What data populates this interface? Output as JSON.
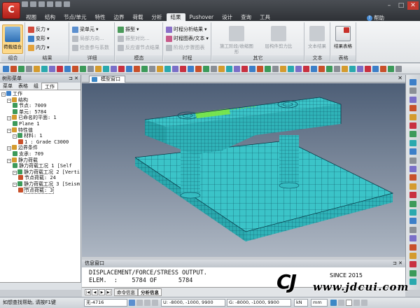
{
  "app": {
    "logo_text": "C",
    "menu_tabs": [
      "视图",
      "结构",
      "节点/单元",
      "特性",
      "边界",
      "荷载",
      "分析",
      "结果",
      "Pushover",
      "设计",
      "查询",
      "工具"
    ],
    "active_tab": "结果",
    "help_label": "帮助"
  },
  "ribbon": {
    "groups": {
      "combo": "组合",
      "results": "结果",
      "detail": "详细",
      "mode": "模态",
      "time": "时程",
      "other": "其它",
      "text": "文本",
      "table": "表格"
    },
    "load_combo_btn": "荷载组合",
    "reaction": "反力",
    "deform": "变形",
    "internal_force": "内力",
    "beam_element": "梁单元",
    "local_direction": "局部方向...",
    "check_params": "检查参与系数",
    "vibration_mode": "振型",
    "mode_compare": "振型对比...",
    "reaction_time": "反应谱节点结果",
    "time_history": "时程分析结果",
    "time_graph": "时程图表/文本",
    "step_graph": "阶段/步骤图表",
    "construction_stage": "施工阶段/收缩图形",
    "member_force_ratio": "层构件剪力比",
    "text_result": "文本结果",
    "result_table": "结果表格"
  },
  "tree": {
    "panel_title": "树形菜单",
    "tabs": [
      "菜单",
      "表格",
      "组",
      "工作"
    ],
    "active_tab": "工作",
    "nodes": [
      {
        "depth": 0,
        "label": "工作",
        "icon": "work-icon"
      },
      {
        "depth": 1,
        "label": "结构",
        "icon": "structure-icon"
      },
      {
        "depth": 2,
        "label": "节点: 7009",
        "icon": "node-icon"
      },
      {
        "depth": 2,
        "label": "单元: 5784",
        "icon": "element-icon"
      },
      {
        "depth": 1,
        "label": "已命名的平面: 1",
        "icon": "plane-icon"
      },
      {
        "depth": 2,
        "label": "Plane 1",
        "icon": "plane-item-icon"
      },
      {
        "depth": 1,
        "label": "特性值",
        "icon": "property-icon"
      },
      {
        "depth": 2,
        "label": "材料: 1",
        "icon": "material-icon"
      },
      {
        "depth": 3,
        "label": "1 : Grade C3000",
        "icon": "grade-icon"
      },
      {
        "depth": 1,
        "label": "边界条件",
        "icon": "boundary-icon"
      },
      {
        "depth": 2,
        "label": "支承: 709",
        "icon": "support-icon"
      },
      {
        "depth": 1,
        "label": "静力荷载",
        "icon": "static-load-icon"
      },
      {
        "depth": 2,
        "label": "静力荷载工况 1 [Self",
        "icon": "loadcase-icon"
      },
      {
        "depth": 2,
        "label": "静力荷载工况 2 [Verti",
        "icon": "loadcase-icon"
      },
      {
        "depth": 3,
        "label": "节点荷载: 24",
        "icon": "nodal-load-icon"
      },
      {
        "depth": 2,
        "label": "静力荷载工况 3 [Seism",
        "icon": "loadcase-icon"
      },
      {
        "depth": 3,
        "label": "节点荷载: 3",
        "icon": "nodal-load-icon"
      }
    ]
  },
  "model_window": {
    "tab_label": "模型窗口"
  },
  "output_window": {
    "title": "信息窗口",
    "lines": [
      "DISPLACEMENT/FORCE/STRESS OUTPUT.",
      "ELEM.  :    5784 OF      5784"
    ],
    "tabs": [
      "命令信息",
      "分析信息"
    ],
    "active_tab": "分析信息"
  },
  "status": {
    "hint": "如想查找帮助, 请按F1键",
    "selection": "无-4716",
    "unit_coords": "U: -8000, -1000, 9900",
    "global_coords": "G: -8000, -1000, 9900",
    "unit": "kN",
    "length": "mm"
  },
  "watermark": {
    "logo": "CJ",
    "since": "SINCE 2015",
    "url": "www.jdcui.com"
  },
  "colors": {
    "mesh_fill": "#35bfc3",
    "mesh_line": "#0b4c5e",
    "highlight": "#7de844",
    "ribbon_active": "#fdd98a"
  }
}
